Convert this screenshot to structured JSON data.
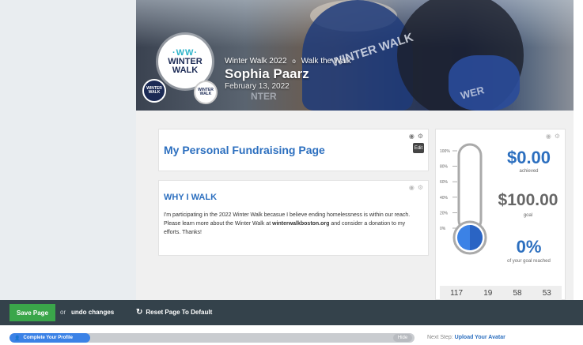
{
  "hero": {
    "event": "Winter Walk 2022",
    "separator": "o",
    "team": "Walk the Walk",
    "name": "Sophia Paarz",
    "date": "February 13, 2022",
    "logo": {
      "mark": "·WW·",
      "line1": "WINTER",
      "line2": "WALK"
    },
    "badge_dark": "WINTER WALK",
    "badge_light": "WINTER WALK"
  },
  "page_card": {
    "title": "My Personal Fundraising Page",
    "edit_label": "Edit"
  },
  "why_card": {
    "title": "WHY I WALK",
    "text_before": "I'm participating in the 2022 Winter Walk becasue I believe ending homelessness is within our reach. Please learn more about the Winter Walk at ",
    "link": "winterwalkboston.org",
    "text_after": " and consider a donation to my efforts.  Thanks!"
  },
  "stats": {
    "achieved_amount": "$0.00",
    "achieved_label": "achieved",
    "goal_amount": "$100.00",
    "goal_label": "goal",
    "percent": "0%",
    "percent_label": "of your goal reached",
    "progress_fraction": 0,
    "thermometer_ticks": [
      "100%",
      "80%",
      "60%",
      "40%",
      "20%",
      "0%"
    ]
  },
  "countdown": [
    "117",
    "19",
    "58",
    "53"
  ],
  "toolbar": {
    "save_label": "Save Page",
    "or_label": "or",
    "undo_label": "undo changes",
    "reset_label": "Reset Page To Default"
  },
  "profile_progress": {
    "label": "Complete Your Profile",
    "hide_label": "Hide",
    "next_prefix": "Next Step:",
    "next_link": "Upload Your Avatar",
    "fill_fraction": 0.2
  },
  "colors": {
    "accent": "#2c6fbf",
    "toolbar_bg": "#34424b",
    "save_green": "#3aa64a",
    "progress_blue": "#3b82e6"
  }
}
